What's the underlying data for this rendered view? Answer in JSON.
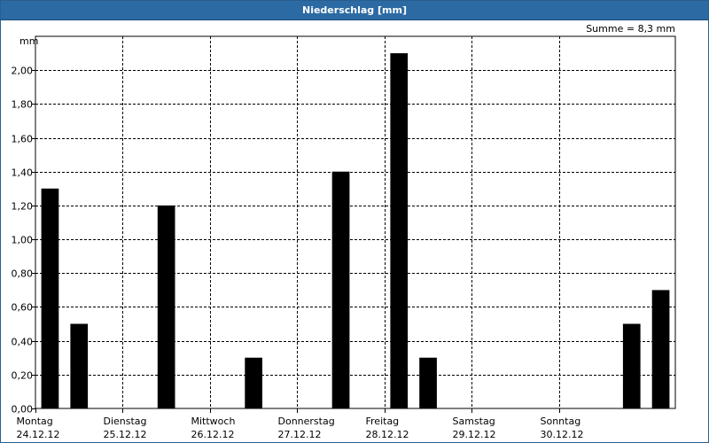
{
  "window": {
    "title": "Niederschlag [mm]"
  },
  "chart_data": {
    "type": "bar",
    "title": "Niederschlag [mm]",
    "ylabel": "mm",
    "sum_label": "Summe = 8,3 mm",
    "ylim": [
      0,
      2.2
    ],
    "yticks": [
      0,
      0.2,
      0.4,
      0.6,
      0.8,
      1.0,
      1.2,
      1.4,
      1.6,
      1.8,
      2.0
    ],
    "ytick_labels": [
      "0,00",
      "0,20",
      "0,40",
      "0,60",
      "0,80",
      "1,00",
      "1,20",
      "1,40",
      "1,60",
      "1,80",
      "2,00"
    ],
    "days": [
      {
        "weekday": "Montag",
        "date": "24.12.12"
      },
      {
        "weekday": "Dienstag",
        "date": "25.12.12"
      },
      {
        "weekday": "Mittwoch",
        "date": "26.12.12"
      },
      {
        "weekday": "Donnerstag",
        "date": "27.12.12"
      },
      {
        "weekday": "Freitag",
        "date": "28.12.12"
      },
      {
        "weekday": "Samstag",
        "date": "29.12.12"
      },
      {
        "weekday": "Sonntag",
        "date": "30.12.12"
      }
    ],
    "bins_per_day": 3,
    "values": [
      1.3,
      0.5,
      0,
      0,
      1.2,
      0,
      0,
      0.3,
      0,
      0,
      1.4,
      0,
      2.1,
      0.3,
      0,
      0,
      0,
      0,
      0,
      0,
      0.5,
      0.7
    ],
    "grid": true,
    "bar_color": "#000000",
    "frame_color": "#2b6aa3"
  }
}
